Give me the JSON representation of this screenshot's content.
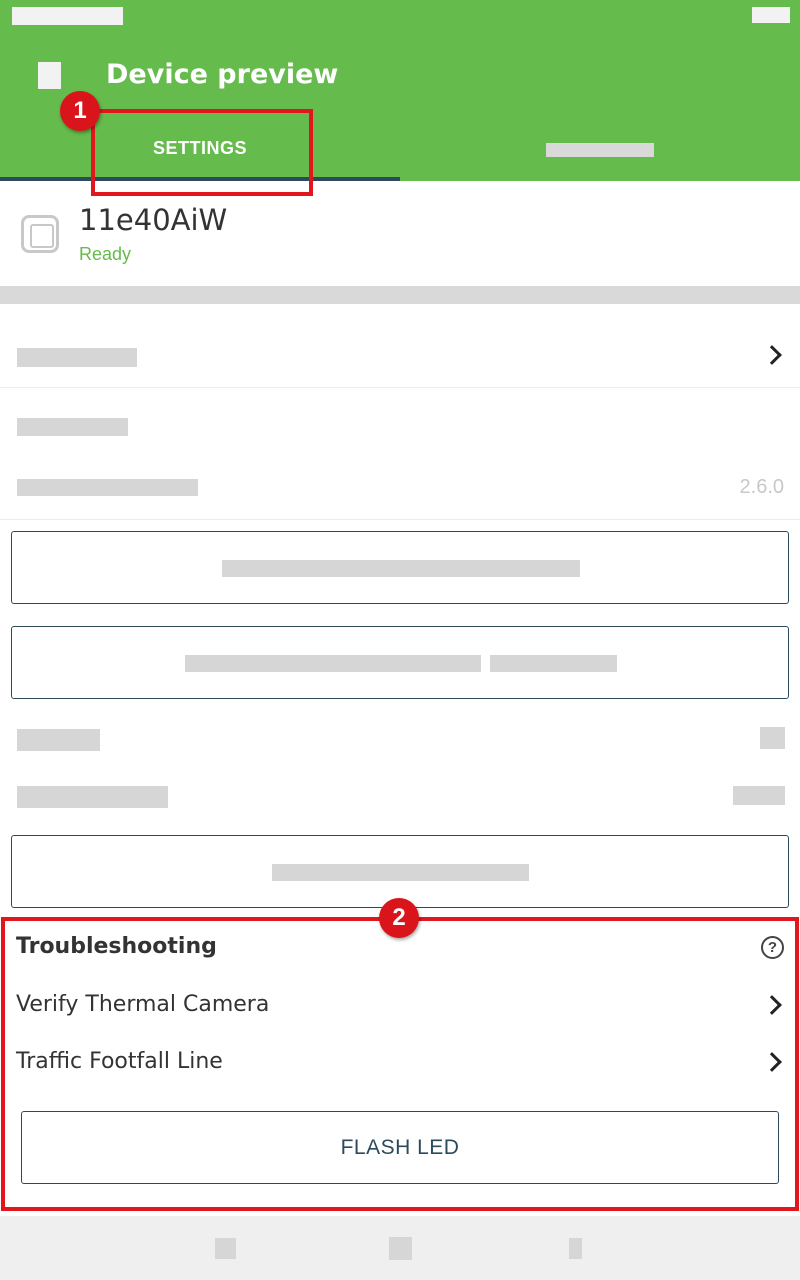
{
  "header": {
    "title": "Device preview",
    "tabs": [
      {
        "label": "SETTINGS",
        "selected": true
      },
      {
        "label": "",
        "selected": false
      }
    ],
    "background_color": "#65bb4b",
    "tab_indicator_color": "#2c4a5c"
  },
  "device": {
    "name": "11e40AiW",
    "status": "Ready",
    "status_color": "#65bb4b",
    "icon": "device-icon"
  },
  "settings": {
    "version": "2.6.0"
  },
  "troubleshooting": {
    "heading": "Troubleshooting",
    "items": [
      {
        "label": "Verify Thermal Camera"
      },
      {
        "label": "Traffic Footfall Line"
      }
    ],
    "flash_button": "FLASH LED"
  },
  "annotations": {
    "badge_1": "1",
    "badge_2": "2",
    "color": "#e0181e"
  }
}
